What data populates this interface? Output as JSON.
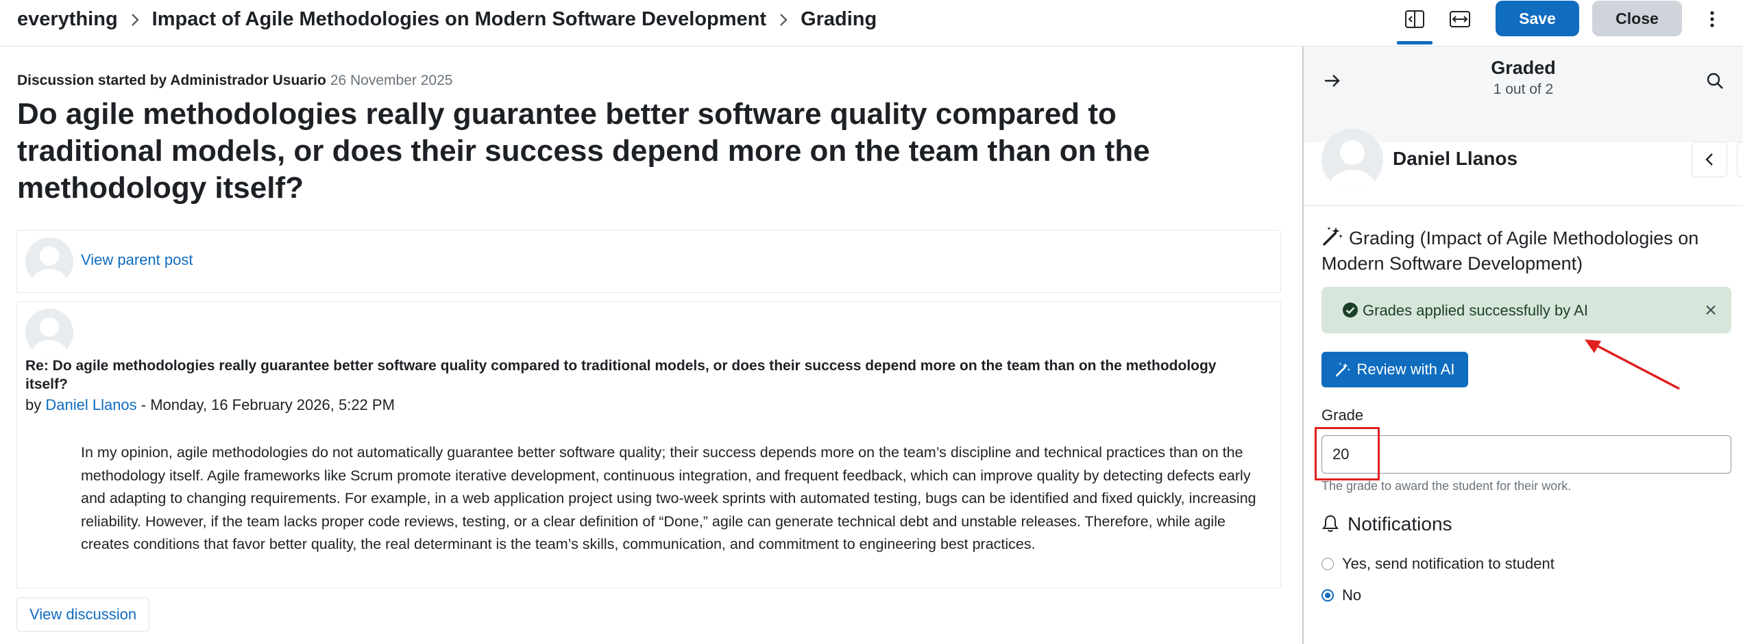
{
  "header": {
    "breadcrumbs": [
      "everything",
      "Impact of Agile Methodologies on Modern Software Development",
      "Grading"
    ],
    "icons": [
      "collapse-panel-icon",
      "expand-width-icon",
      "kebab-menu-icon"
    ],
    "save_label": "Save",
    "close_label": "Close"
  },
  "discussion": {
    "started_prefix": "Discussion started by Administrador Usuario",
    "started_date": "26 November 2025",
    "title": "Do agile methodologies really guarantee better software quality compared to traditional models, or does their success depend more on the team than on the methodology itself?",
    "parent_link": "View parent post",
    "post": {
      "subject": "Re: Do agile methodologies really guarantee better software quality compared to traditional models, or does their success depend more on the team than on the methodology itself?",
      "by_prefix": "by ",
      "author": "Daniel Llanos",
      "date": " - Monday, 16 February 2026, 5:22 PM",
      "body": "In my opinion, agile methodologies do not automatically guarantee better software quality; their success depends more on the team’s discipline and technical practices than on the methodology itself. Agile frameworks like Scrum promote iterative development, continuous integration, and frequent feedback, which can improve quality by detecting defects early and adapting to changing requirements. For example, in a web application project using two-week sprints with automated testing, bugs can be identified and fixed quickly, increasing reliability. However, if the team lacks proper code reviews, testing, or a clear definition of “Done,” agile can generate technical debt and unstable releases. Therefore, while agile creates conditions that favor better quality, the real determinant is the team’s skills, communication, and commitment to engineering best practices."
    },
    "view_discussion_label": "View discussion"
  },
  "panel": {
    "status": "Graded",
    "count": "1 out of 2",
    "student_name": "Daniel Llanos",
    "grading_title": "Grading (Impact of Agile Methodologies on Modern Software Development)",
    "alert_text": "Grades applied successfully by AI",
    "review_label": "Review with AI",
    "grade_label": "Grade",
    "grade_value": "20",
    "grade_help": "The grade to award the student for their work.",
    "notifications_title": "Notifications",
    "notify_options": [
      {
        "label": "Yes, send notification to student",
        "checked": false
      },
      {
        "label": "No",
        "checked": true
      }
    ]
  },
  "colors": {
    "primary": "#0f6cbf",
    "alert_bg": "#d7e6da",
    "alert_text": "#1c3f29",
    "annotation": "#e02020"
  }
}
